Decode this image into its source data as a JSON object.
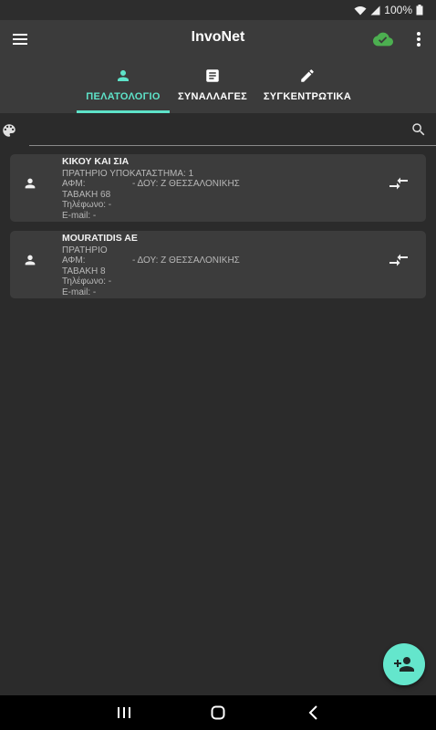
{
  "status_bar": {
    "battery": "100%",
    "icons": [
      "wifi-icon",
      "signal-icon",
      "battery-icon"
    ]
  },
  "app_bar": {
    "title": "InvoNet",
    "icons": [
      "menu-icon",
      "cloud-check-icon",
      "more-vert-icon"
    ],
    "cloud_color": "#4caf50"
  },
  "tabs": [
    {
      "label": "ΠΕΛΑΤΟΛΟΓΙΟ",
      "icon": "person-icon",
      "active": true
    },
    {
      "label": "ΣΥΝΑΛΛΑΓΕΣ",
      "icon": "receipt-icon",
      "active": false
    },
    {
      "label": "ΣΥΓΚΕΝΤΡΩΤΙΚΑ",
      "icon": "edit-icon",
      "active": false
    }
  ],
  "search": {
    "placeholder": "",
    "value": ""
  },
  "customers": [
    {
      "name": "ΚΙΚΟΥ ΚΑΙ ΣΙΑ",
      "subtitle": "ΠΡΑΤΗΡΙΟ ΥΠΟΚΑΤΑΣΤΗΜΑ: 1",
      "afm": "ΑΦΜ:",
      "doy": "-  ΔΟΥ: Ζ ΘΕΣΣΑΛΟΝΙΚΗΣ",
      "address": "ΤΑΒΑΚΗ 68",
      "phone": "Τηλέφωνο:  -",
      "email": "E-mail:  -"
    },
    {
      "name": "MOURATIDIS AE",
      "subtitle": "ΠΡΑΤΗΡΙΟ",
      "afm": "ΑΦΜ:",
      "doy": "-  ΔΟΥ: Ζ ΘΕΣΣΑΛΟΝΙΚΗΣ",
      "address": "ΤΑΒΑΚΗ 8",
      "phone": "Τηλέφωνο:  -",
      "email": "E-mail:  -"
    }
  ],
  "fab": {
    "icon": "person-add-icon",
    "color": "#64e6cc"
  },
  "nav_bar": {
    "icons": [
      "recents-icon",
      "home-icon",
      "back-icon"
    ]
  },
  "colors": {
    "accent": "#5ee3c9",
    "background": "#2b2b2b",
    "app_bar": "#3b3b3b",
    "card": "#3c3c3c"
  }
}
